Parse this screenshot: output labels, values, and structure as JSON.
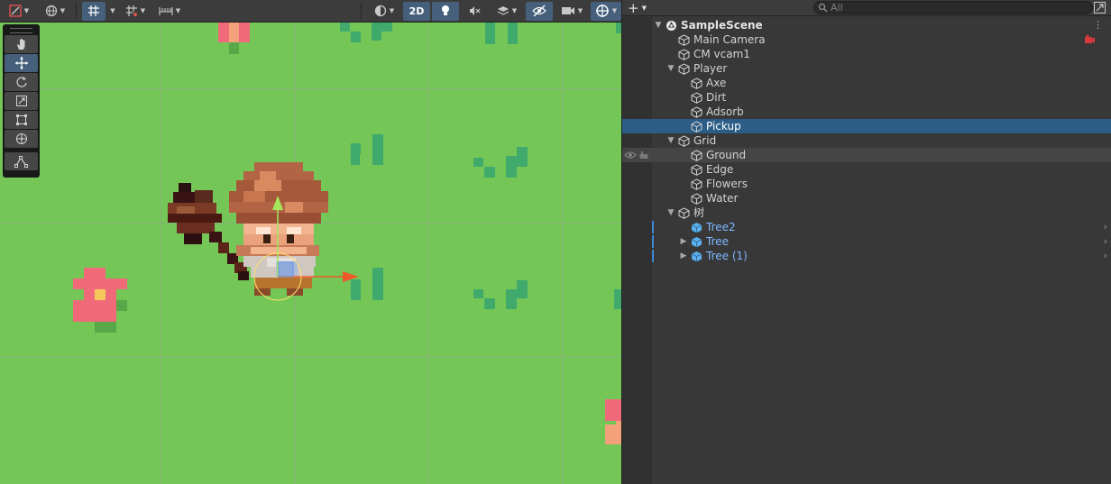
{
  "scene_view": {
    "toolbar": {
      "draw_mode_icon": "shading-mode-icon",
      "gizmo_global_icon": "globe-icon",
      "grid_snap_icon": "grid-snap-icon",
      "increment_snap_icon": "increment-snap-icon",
      "ruler_icon": "ruler-icon",
      "render_mode_icon": "render-mode-icon",
      "mode_2d_label": "2D",
      "lighting_icon": "lightbulb-icon",
      "audio_icon": "audio-muted-icon",
      "effects_icon": "layers-icon",
      "hidden_objects_icon": "eye-hidden-icon",
      "camera_icon": "camera-icon",
      "gizmos_icon": "gizmos-icon"
    },
    "tools": [
      "hand-tool-icon",
      "move-tool-icon",
      "rotate-tool-icon",
      "scale-tool-icon",
      "rect-tool-icon",
      "transform-tool-icon",
      "custom-editor-tool-icon"
    ],
    "active_tool": "move-tool-icon",
    "colors": {
      "grass": "#74c657",
      "grid_line": "#8ab27c",
      "grass_tuft": "#3faa6c",
      "flower_petal": "#f06a7a",
      "flower_center": "#f4c95a",
      "flower_leaf": "#58a84a",
      "move_y_arrow": "#a4e65c",
      "move_x_arrow": "#f05a2a",
      "selection_accent": "#46607c"
    }
  },
  "hierarchy": {
    "add_label": "+",
    "search": {
      "placeholder": "All",
      "value": ""
    },
    "items": [
      {
        "label": "SampleScene",
        "depth": 0,
        "expanded": true,
        "kind": "scene"
      },
      {
        "label": "Main Camera",
        "depth": 1,
        "kind": "object",
        "badge": "camera-warning-icon"
      },
      {
        "label": "CM vcam1",
        "depth": 1,
        "kind": "object"
      },
      {
        "label": "Player",
        "depth": 1,
        "expanded": true,
        "kind": "object"
      },
      {
        "label": "Axe",
        "depth": 2,
        "kind": "object"
      },
      {
        "label": "Dirt",
        "depth": 2,
        "kind": "object"
      },
      {
        "label": "Adsorb",
        "depth": 2,
        "kind": "object"
      },
      {
        "label": "Pickup",
        "depth": 2,
        "kind": "object",
        "selected": true
      },
      {
        "label": "Grid",
        "depth": 1,
        "expanded": true,
        "kind": "object"
      },
      {
        "label": "Ground",
        "depth": 2,
        "kind": "object",
        "hover": true
      },
      {
        "label": "Edge",
        "depth": 2,
        "kind": "object"
      },
      {
        "label": "Flowers",
        "depth": 2,
        "kind": "object"
      },
      {
        "label": "Water",
        "depth": 2,
        "kind": "object"
      },
      {
        "label": "树",
        "depth": 1,
        "expanded": true,
        "kind": "object"
      },
      {
        "label": "Tree2",
        "depth": 2,
        "kind": "prefab"
      },
      {
        "label": "Tree",
        "depth": 2,
        "collapsed": true,
        "kind": "prefab"
      },
      {
        "label": "Tree (1)",
        "depth": 2,
        "collapsed": true,
        "kind": "prefab"
      }
    ],
    "colors": {
      "panel": "#383838",
      "selected_row": "#2c5d87",
      "prefab_label": "#7fb8ff",
      "prefab_icon": "#5ab0ee"
    }
  }
}
